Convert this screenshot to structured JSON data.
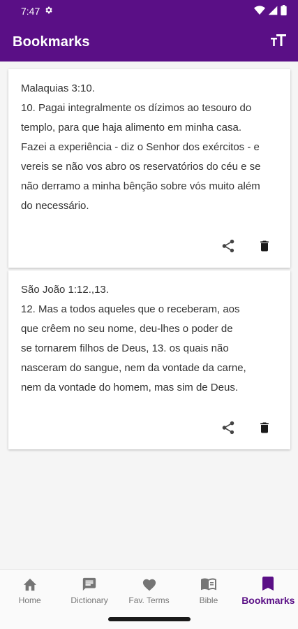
{
  "status_bar": {
    "time": "7:47",
    "icons": [
      "gear-icon",
      "wifi-icon",
      "signal-icon",
      "battery-icon"
    ]
  },
  "app_bar": {
    "title": "Bookmarks",
    "action_icon": "text-size-icon"
  },
  "bookmarks": [
    {
      "reference": "Malaquias 3:10.",
      "lines": [
        "10. Pagai integralmente os dízimos ao tesouro do",
        "templo, para que haja alimento em minha casa.",
        "Fazei a experiência - diz o Senhor dos exércitos - e",
        "vereis se não vos abro os reservatórios do céu e se",
        "não derramo a minha bênção sobre vós muito além",
        "do necessário."
      ]
    },
    {
      "reference": "São João 1:12.,13.",
      "lines": [
        "12. Mas a todos aqueles que o receberam, aos",
        "que crêem no seu nome, deu-lhes o poder de",
        "se tornarem filhos de Deus, 13. os quais não",
        "nasceram do sangue, nem da vontade da carne,",
        "nem da vontade do homem, mas sim de Deus."
      ]
    }
  ],
  "bottom_nav": [
    {
      "label": "Home",
      "icon": "home-icon",
      "active": false
    },
    {
      "label": "Dictionary",
      "icon": "dictionary-icon",
      "active": false
    },
    {
      "label": "Fav. Terms",
      "icon": "heart-icon",
      "active": false
    },
    {
      "label": "Bible",
      "icon": "book-icon",
      "active": false
    },
    {
      "label": "Bookmarks",
      "icon": "bookmark-icon",
      "active": true
    }
  ],
  "colors": {
    "primary": "#5a0f86",
    "nav_inactive": "#757575",
    "text": "#333333"
  }
}
